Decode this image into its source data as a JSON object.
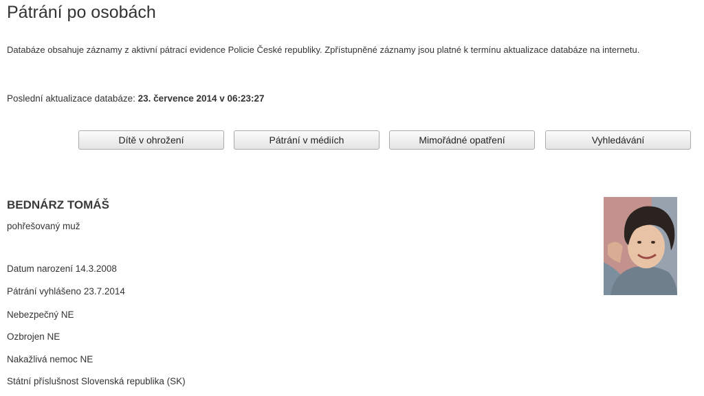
{
  "page": {
    "title": "Pátrání po osobách",
    "intro": "Databáze obsahuje záznamy z aktivní pátrací evidence Policie České republiky. Zpřístupněné záznamy jsou platné k termínu aktualizace databáze na internetu.",
    "update_label": "Poslední aktualizace databáze:",
    "update_value": "23. července 2014 v 06:23:27"
  },
  "nav": {
    "buttons": [
      {
        "label": "Dítě v ohrožení"
      },
      {
        "label": "Pátrání v médiích"
      },
      {
        "label": "Mimořádné opatření"
      },
      {
        "label": "Vyhledávání"
      }
    ]
  },
  "person": {
    "name": "BEDNÁRZ TOMÁŠ",
    "type": "pohřešovaný muž",
    "details": [
      "Datum narození 14.3.2008",
      "Pátrání vyhlášeno 23.7.2014",
      "Nebezpečný NE",
      "Ozbrojen NE",
      "Nakažlivá nemoc NE",
      "Státní příslušnost Slovenská republika (SK)"
    ]
  }
}
